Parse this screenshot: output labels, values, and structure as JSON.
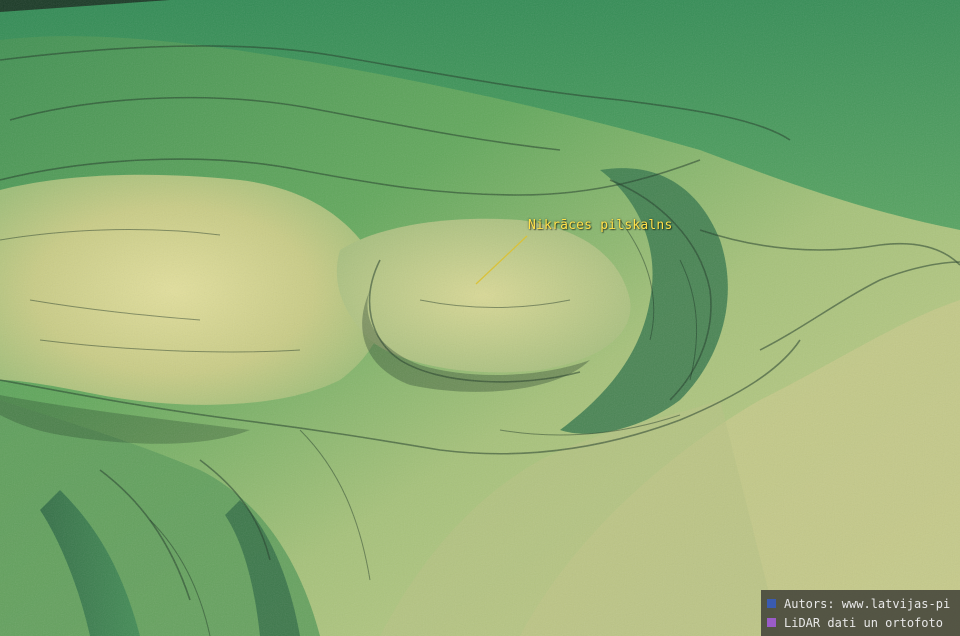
{
  "map": {
    "label": "Nikrāces pilskalns",
    "legend": [
      {
        "text": "Autors: www.latvijas-pi",
        "color": "#3a5bb0"
      },
      {
        "text": "LiDAR dati un ortofoto",
        "color": "#9a5cc8"
      }
    ]
  }
}
